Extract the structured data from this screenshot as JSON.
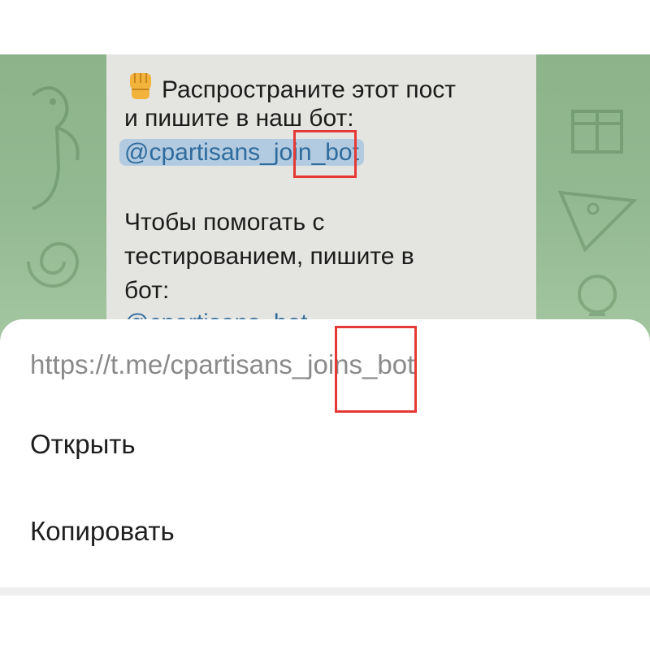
{
  "message": {
    "line1": "Распространите этот пост",
    "line2": "и пишите в наш бот:",
    "link1": "@cpartisans_join_bot",
    "line4": "Чтобы помогать с",
    "line5": "тестированием, пишите в",
    "line6": "бот:",
    "link2_partial": "@cpartisans_bot"
  },
  "sheet": {
    "url": "https://t.me/cpartisans_joins_bot",
    "open_label": "Открыть",
    "copy_label": "Копировать"
  },
  "icons": {
    "fist": "raised-fist-emoji"
  },
  "colors": {
    "wallpaper": "#8db38a",
    "bubble": "#e4e4e1",
    "link": "#2f6b9c",
    "link_highlight": "#b2cbe0",
    "annotation": "#e53935",
    "url_text": "#8a8a8a"
  }
}
